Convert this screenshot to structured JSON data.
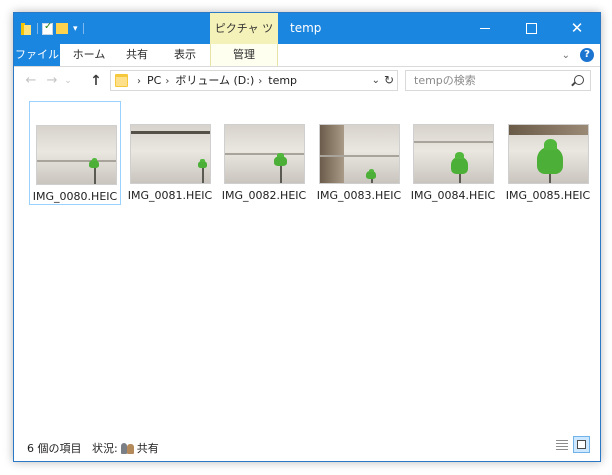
{
  "window": {
    "title": "temp",
    "context_tab_group": "ピクチャ ツール",
    "controls": {
      "minimize": "minimize",
      "maximize": "maximize",
      "close": "✕"
    }
  },
  "quick_access": {
    "icons": [
      "folder-icon",
      "properties-icon",
      "new-folder-icon",
      "customize-dropdown-icon"
    ]
  },
  "ribbon": {
    "tabs": [
      {
        "label": "ファイル",
        "active": true
      },
      {
        "label": "ホーム"
      },
      {
        "label": "共有"
      },
      {
        "label": "表示"
      },
      {
        "label": "管理",
        "contextual": true
      }
    ],
    "help": "?"
  },
  "navigation": {
    "back": "←",
    "forward": "→",
    "recent": "⌄",
    "up": "↑",
    "breadcrumb": [
      "PC",
      "ボリューム (D:)",
      "temp"
    ],
    "search_placeholder": "tempの検索"
  },
  "files": [
    {
      "name": "IMG_0080.HEIC",
      "selected": true
    },
    {
      "name": "IMG_0081.HEIC"
    },
    {
      "name": "IMG_0082.HEIC"
    },
    {
      "name": "IMG_0083.HEIC"
    },
    {
      "name": "IMG_0084.HEIC"
    },
    {
      "name": "IMG_0085.HEIC"
    }
  ],
  "status": {
    "item_count": "6 個の項目",
    "state_label": "状況:",
    "state_value": "共有"
  },
  "colors": {
    "accent": "#1b86df",
    "context_tab": "#f4f2b8",
    "selection_border": "#99d1ff"
  }
}
